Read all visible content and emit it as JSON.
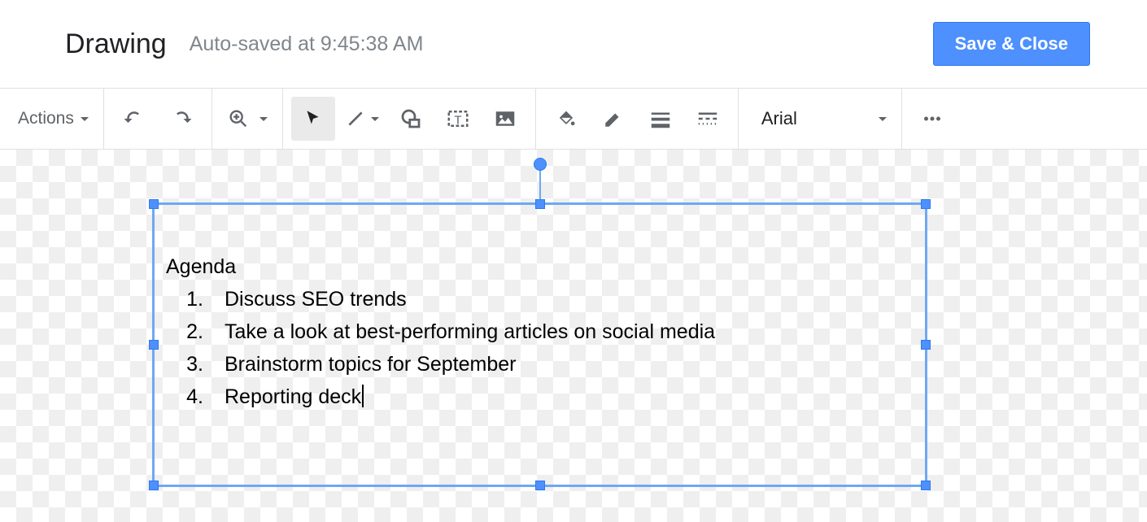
{
  "header": {
    "title": "Drawing",
    "autosave": "Auto-saved at 9:45:38 AM",
    "save_button": "Save & Close"
  },
  "toolbar": {
    "actions_label": "Actions",
    "font_name": "Arial"
  },
  "textbox": {
    "heading": "Agenda",
    "items": [
      {
        "n": "1.",
        "text": "Discuss SEO trends"
      },
      {
        "n": "2.",
        "text": "Take a look at best-performing articles on social media"
      },
      {
        "n": "3.",
        "text": "Brainstorm topics for September"
      },
      {
        "n": "4.",
        "text": "Reporting deck"
      }
    ]
  }
}
